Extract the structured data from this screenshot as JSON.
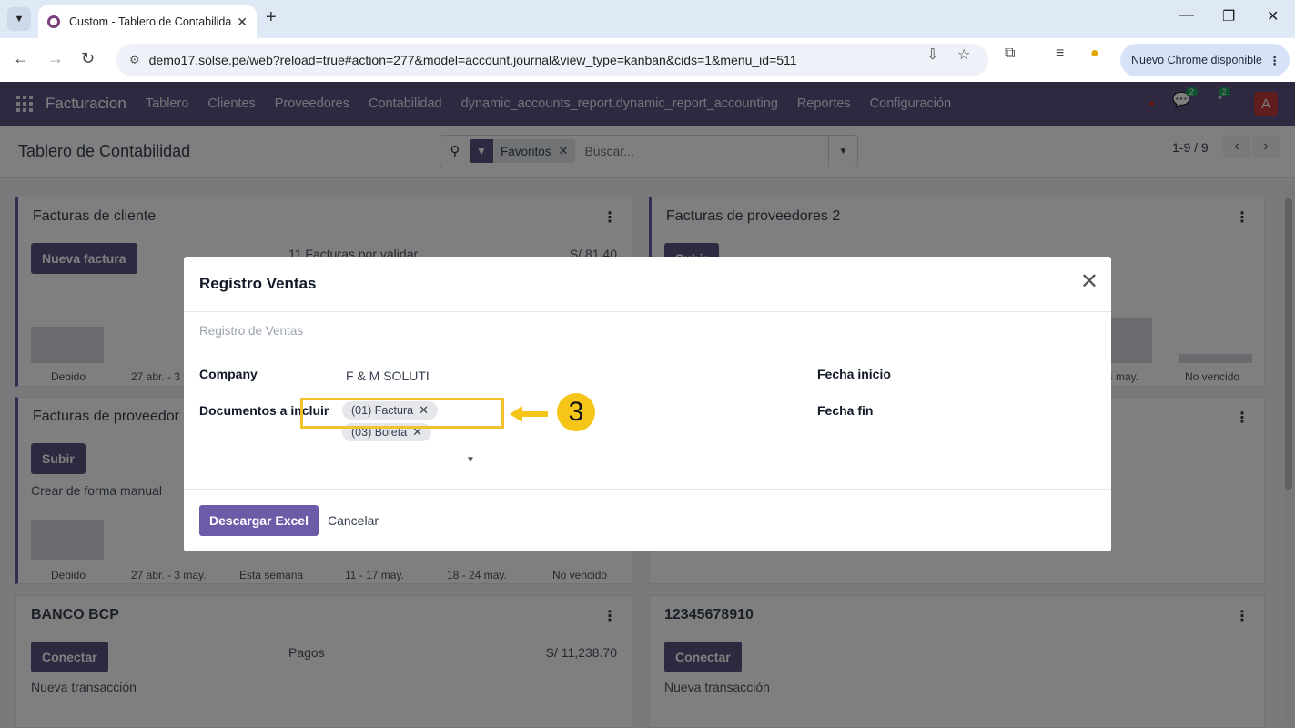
{
  "browser": {
    "tab_title": "Custom - Tablero de Contabilidad",
    "url": "demo17.solse.pe/web?reload=true#action=277&model=account.journal&view_type=kanban&cids=1&menu_id=511",
    "update_label": "Nuevo Chrome disponible"
  },
  "navbar": {
    "brand": "Facturacion",
    "menu": [
      "Tablero",
      "Clientes",
      "Proveedores",
      "Contabilidad",
      "dynamic_accounts_report.dynamic_report_accounting",
      "Reportes",
      "Configuración"
    ],
    "messages_count": "2",
    "activities_count": "2",
    "avatar_letter": "A"
  },
  "control_panel": {
    "title": "Tablero de Contabilidad",
    "facet_label": "Favoritos",
    "search_placeholder": "Buscar...",
    "pager": "1-9 / 9"
  },
  "cards": {
    "customer_invoices": {
      "title": "Facturas de cliente",
      "button": "Nueva factura",
      "pending": "11 Facturas por validar",
      "amount": "S/ 81.40",
      "axis": [
        "Debido",
        "27 abr. - 3 may."
      ]
    },
    "vendor_bills_2": {
      "title": "Facturas de proveedores 2",
      "button": "Subir",
      "axis": [
        "4 may.",
        "No vencido"
      ]
    },
    "vendor_bills": {
      "title": "Facturas de proveedor",
      "button": "Subir",
      "manual": "Crear de forma manual",
      "axis": [
        "Debido",
        "27 abr. - 3 may.",
        "Esta semana",
        "11 - 17 may.",
        "18 - 24 may.",
        "No vencido"
      ]
    },
    "bank_bcp": {
      "title": "BANCO BCP",
      "button": "Conectar",
      "payments": "Pagos",
      "amount": "S/ 11,238.70",
      "new_tx": "Nueva transacción"
    },
    "account_12345": {
      "title": "12345678910",
      "button": "Conectar",
      "new_tx": "Nueva transacción"
    }
  },
  "modal": {
    "title": "Registro Ventas",
    "subtitle": "Registro de Ventas",
    "company_label": "Company",
    "company_value": "F & M SOLUTI",
    "docs_label": "Documentos a incluir",
    "tags": [
      "(01) Factura",
      "(03) Boleta"
    ],
    "start_date_label": "Fecha inicio",
    "end_date_label": "Fecha fin",
    "download_label": "Descargar Excel",
    "cancel_label": "Cancelar"
  },
  "annotation": {
    "step": "3",
    "color": "#f5c518"
  },
  "colors": {
    "brand": "#5e5182",
    "primary_button": "#6d5ba8"
  }
}
